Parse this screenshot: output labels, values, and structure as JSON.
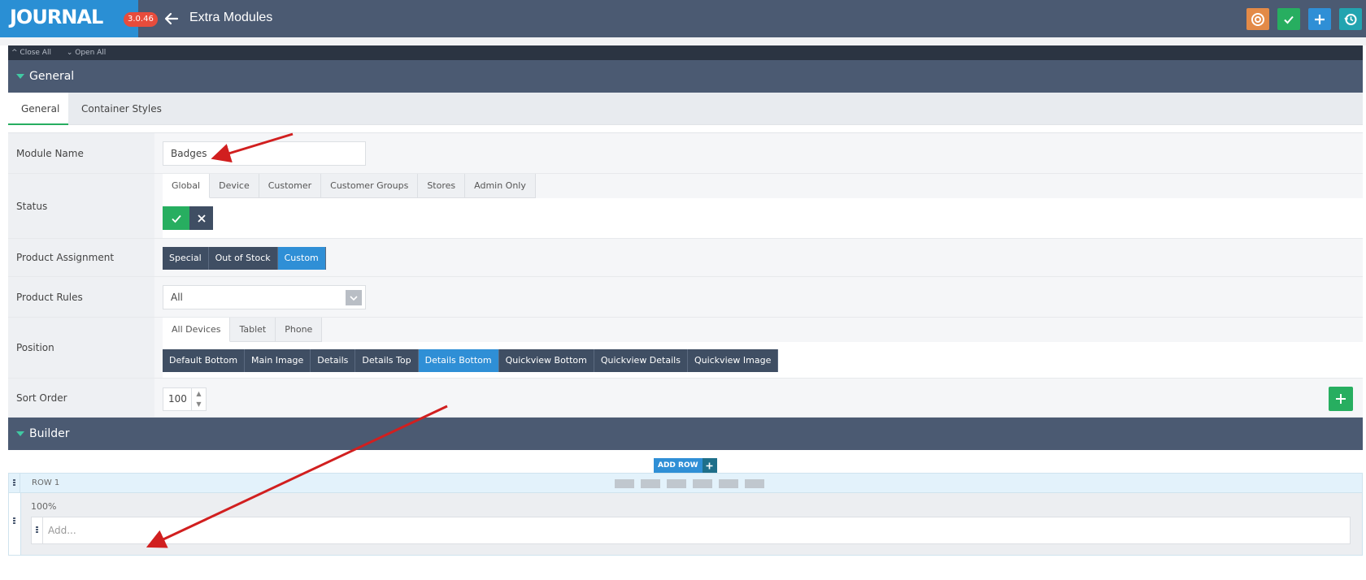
{
  "header": {
    "logo": "JOURNAL",
    "version": "3.0.46",
    "title": "Extra Modules",
    "actions": [
      {
        "name": "support-button",
        "icon": "lifebuoy-icon",
        "color": "#e38a47"
      },
      {
        "name": "save-button",
        "icon": "check-icon",
        "color": "#27ae60"
      },
      {
        "name": "add-button",
        "icon": "plus-icon",
        "color": "#2f8fd6"
      },
      {
        "name": "history-button",
        "icon": "history-icon",
        "color": "#22a4b0"
      }
    ]
  },
  "toolbar": {
    "close_all": "Close All",
    "open_all": "Open All"
  },
  "general": {
    "section_title": "General",
    "tabs": [
      "General",
      "Container Styles"
    ],
    "fields": {
      "module_name": {
        "label": "Module Name",
        "value": "Badges"
      },
      "status": {
        "label": "Status",
        "tabs": [
          "Global",
          "Device",
          "Customer",
          "Customer Groups",
          "Stores",
          "Admin Only"
        ],
        "enabled": true
      },
      "product_assignment": {
        "label": "Product Assignment",
        "options": [
          "Special",
          "Out of Stock",
          "Custom"
        ],
        "selected": "Custom"
      },
      "product_rules": {
        "label": "Product Rules",
        "value": "All"
      },
      "position": {
        "label": "Position",
        "tabs": [
          "All Devices",
          "Tablet",
          "Phone"
        ],
        "options": [
          "Default Bottom",
          "Main Image",
          "Details",
          "Details Top",
          "Details Bottom",
          "Quickview Bottom",
          "Quickview Details",
          "Quickview Image"
        ],
        "selected": "Details Bottom"
      },
      "sort_order": {
        "label": "Sort Order",
        "value": "100"
      }
    }
  },
  "builder": {
    "section_title": "Builder",
    "add_row_label": "ADD ROW",
    "row": {
      "label": "ROW 1",
      "column_width": "100%",
      "placeholder": "Add..."
    }
  },
  "colors": {
    "accent_green": "#27ae60",
    "accent_blue": "#2f8fd6",
    "header_bg": "#4b5a72"
  }
}
